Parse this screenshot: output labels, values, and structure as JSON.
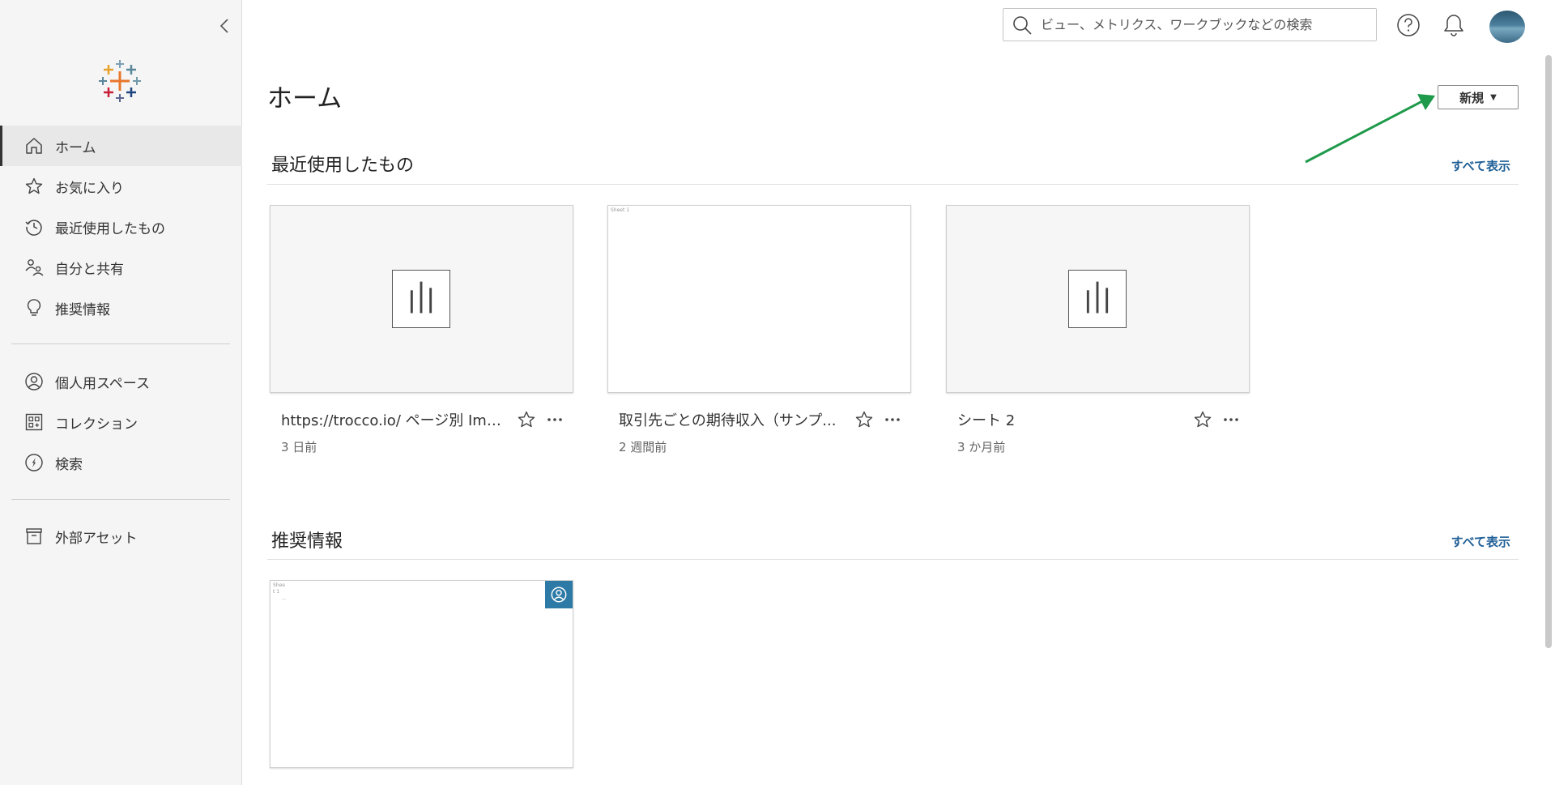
{
  "sidebar": {
    "items": [
      {
        "label": "ホーム",
        "icon": "home-icon"
      },
      {
        "label": "お気に入り",
        "icon": "star-icon"
      },
      {
        "label": "最近使用したもの",
        "icon": "clock-icon"
      },
      {
        "label": "自分と共有",
        "icon": "shared-users-icon"
      },
      {
        "label": "推奨情報",
        "icon": "lightbulb-icon"
      },
      {
        "label": "個人用スペース",
        "icon": "user-circle-icon"
      },
      {
        "label": "コレクション",
        "icon": "collection-icon"
      },
      {
        "label": "検索",
        "icon": "compass-icon"
      },
      {
        "label": "外部アセット",
        "icon": "archive-box-icon"
      }
    ]
  },
  "search": {
    "placeholder": "ビュー、メトリクス、ワークブックなどの検索"
  },
  "main": {
    "title": "ホーム",
    "new_button": "新規",
    "recent": {
      "title": "最近使用したもの",
      "show_all": "すべて表示",
      "cards": [
        {
          "title": "https://trocco.io/ ページ別 Imp...",
          "subtitle": "3 日前"
        },
        {
          "title": "取引先ごとの期待収入（サンプ...",
          "subtitle": "2 週間前",
          "thumb_text": "Sheet 1"
        },
        {
          "title": "シート 2",
          "subtitle": "3 か月前"
        }
      ]
    },
    "recommended": {
      "title": "推奨情報",
      "show_all": "すべて表示",
      "thumb_text_1": "Shee",
      "thumb_text_2": "t 1",
      "thumb_text_3": "···"
    }
  },
  "colors": {
    "accent_link": "#1f5f96",
    "badge": "#2e7aa6",
    "arrow": "#1e9a4a"
  }
}
